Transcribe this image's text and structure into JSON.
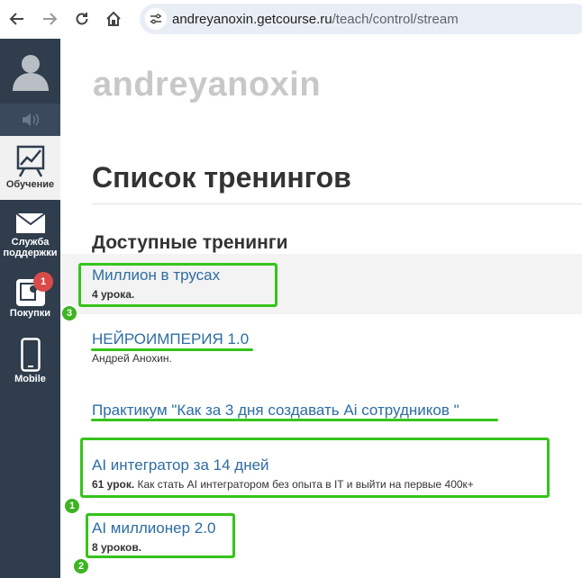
{
  "browser": {
    "url_host": "andreyanoxin.getcourse.ru",
    "url_path": "/teach/control/stream"
  },
  "sidebar": {
    "items": [
      {
        "label": "Обучение",
        "icon": "chart-icon",
        "active": true
      },
      {
        "label_line1": "Служба",
        "label_line2": "поддержки",
        "icon": "mail-icon"
      },
      {
        "label": "Покупки",
        "icon": "purchases-icon",
        "badge": "1"
      },
      {
        "label": "Mobile",
        "icon": "phone-icon"
      }
    ]
  },
  "main": {
    "school_title": "andreyanoxin",
    "page_title": "Список тренингов",
    "section_title": "Доступные тренинги",
    "trainings": [
      {
        "title": "Миллион в трусах",
        "count": "4 урока.",
        "description": ""
      },
      {
        "title": "НЕЙРОИМПЕРИЯ 1.0",
        "count": "",
        "description": "Андрей Анохин."
      },
      {
        "title": "Практикум \"Как за 3 дня создавать Ai сотрудников \"",
        "count": "",
        "description": ""
      },
      {
        "title": "AI интегратор за 14 дней",
        "count": "61 урок.",
        "description": "Как стать AI интегратором без опыта в IT и выйти на первые 400к+"
      },
      {
        "title": "AI миллионер 2.0",
        "count": "8 уроков.",
        "description": ""
      }
    ]
  },
  "annotations": {
    "marker_1": "1",
    "marker_2": "2",
    "marker_3": "3",
    "color": "#35c41b"
  }
}
